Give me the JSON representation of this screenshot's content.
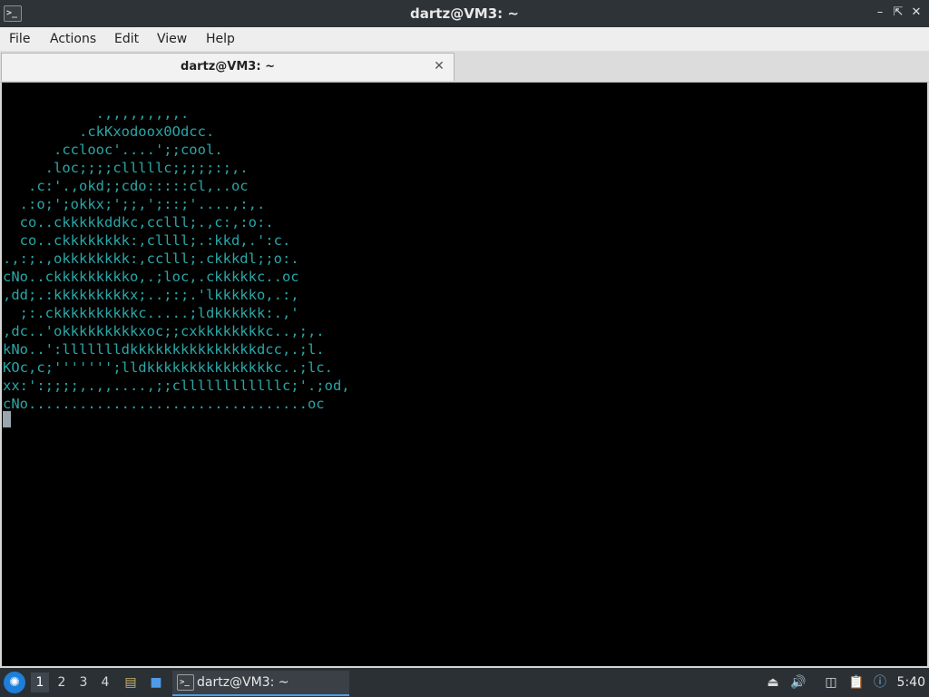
{
  "window": {
    "title": "dartz@VM3: ~",
    "icons": {
      "app": "terminal-icon",
      "minimize": "minimize-icon",
      "maximize": "maximize-icon",
      "close": "close-icon"
    }
  },
  "menubar": {
    "items": [
      "File",
      "Actions",
      "Edit",
      "View",
      "Help"
    ]
  },
  "tabs": [
    {
      "label": "dartz@VM3: ~",
      "active": true
    }
  ],
  "terminal": {
    "text_color": "#2aa6a6",
    "background": "#000000",
    "lines": [
      "           .,,,,,,,,,.",
      "         .ckKxodoox0Odcc.",
      "      .cclooc'....';;cool.",
      "     .loc;;;;clllllc;;;;;:;,.",
      "   .c:'.,okd;;cdo:::::cl,..oc",
      "  .:o;';okkx;';;,';::;'....,:,.",
      "  co..ckkkkkddkc,cclll;.,c:,:o:.",
      "  co..ckkkkkkkk:,cllll;.:kkd,.':c.",
      ".,:;.,okkkkkkkk:,cclll;.ckkkdl;;o:.",
      "cNo..ckkkkkkkkko,.;loc,.ckkkkkc..oc",
      ",dd;.:kkkkkkkkkx;..;:;.'lkkkkko,.:,",
      "  ;:.ckkkkkkkkkkc.....;ldkkkkkk:.,'",
      ",dc..'okkkkkkkkkxoc;;cxkkkkkkkkc..,;,.",
      "kNo..':llllllldkkkkkkkkkkkkkkkdcc,.;l.",
      "KOc,c;''''''';lldkkkkkkkkkkkkkkkc..;lc.",
      "xx:':;;;;,.,,....,;;cllllllllllllc;'.;od,",
      "cNo.................................oc"
    ]
  },
  "taskbar": {
    "start_icon": "start-menu-icon",
    "workspaces": [
      "1",
      "2",
      "3",
      "4"
    ],
    "active_workspace": "1",
    "launchers": [
      "file-manager-icon",
      "desktop-icon"
    ],
    "task": {
      "label": "dartz@VM3: ~",
      "icon": "terminal-icon"
    },
    "tray": [
      "eject-icon",
      "volume-icon",
      "network-icon",
      "clipboard-icon",
      "notification-icon"
    ],
    "clock": "5:40"
  }
}
